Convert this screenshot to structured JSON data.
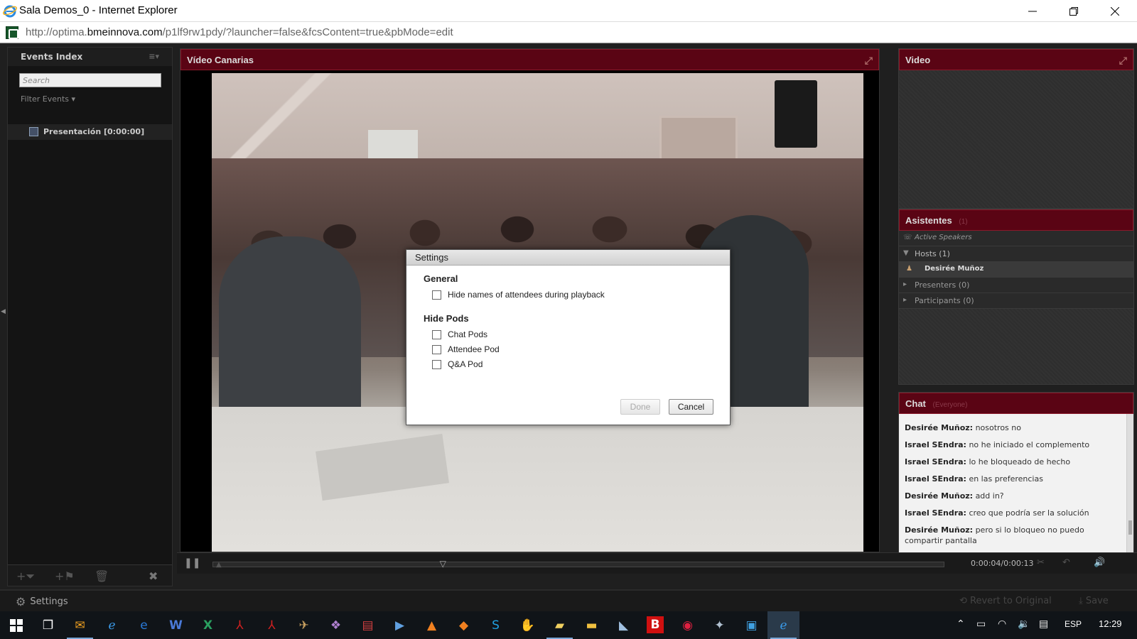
{
  "window": {
    "title": "Sala Demos_0 - Internet Explorer"
  },
  "address": {
    "url_prefix": "http://optima.",
    "url_domain": "bmeinnova.com",
    "url_path": "/p1lf9rw1pdy/?launcher=false&fcsContent=true&pbMode=edit"
  },
  "events_panel": {
    "title": "Events Index",
    "search_placeholder": "Search",
    "filter_label": "Filter Events",
    "items": [
      {
        "label": "Presentación [0:00:00]"
      }
    ]
  },
  "video_pod": {
    "title": "Vídeo Canarias"
  },
  "right_video_pod": {
    "title": "Video"
  },
  "attendees_pod": {
    "title": "Asistentes",
    "count_badge": "(1)",
    "rows": [
      {
        "label": "Active Speakers"
      },
      {
        "label": "Hosts (1)"
      },
      {
        "label": "Desirée Muñoz"
      },
      {
        "label": "Presenters (0)"
      },
      {
        "label": "Participants (0)"
      }
    ]
  },
  "chat_pod": {
    "title": "Chat",
    "scope": "(Everyone)",
    "messages": [
      {
        "author": "Desirée Muñoz:",
        "text": "nosotros no"
      },
      {
        "author": "Israel SEndra:",
        "text": "no he iniciado el complemento"
      },
      {
        "author": "Israel SEndra:",
        "text": "lo he bloqueado de hecho"
      },
      {
        "author": "Israel SEndra:",
        "text": "en las preferencias"
      },
      {
        "author": "Desirée Muñoz:",
        "text": "add in?"
      },
      {
        "author": "Israel SEndra:",
        "text": "creo que podría ser la solución"
      },
      {
        "author": "Desirée Muñoz:",
        "text": "pero si lo bloqueo no puedo compartir pantalla"
      }
    ]
  },
  "playback": {
    "time": "0:00:04/0:00:13",
    "progress_fraction": 0.31
  },
  "bottom_bar": {
    "settings_label": "Settings",
    "revert_label": "Revert to Original",
    "save_label": "Save"
  },
  "settings_dialog": {
    "title": "Settings",
    "general_label": "General",
    "hide_names_label": "Hide names of attendees during playback",
    "hide_pods_label": "Hide Pods",
    "chat_pods_label": "Chat Pods",
    "attendee_pod_label": "Attendee Pod",
    "qa_pod_label": "Q&A Pod",
    "done_label": "Done",
    "cancel_label": "Cancel"
  },
  "taskbar": {
    "language": "ESP",
    "clock": "12:29"
  },
  "colors": {
    "pod_header": "#5a0414",
    "background": "#1f1f1f"
  }
}
